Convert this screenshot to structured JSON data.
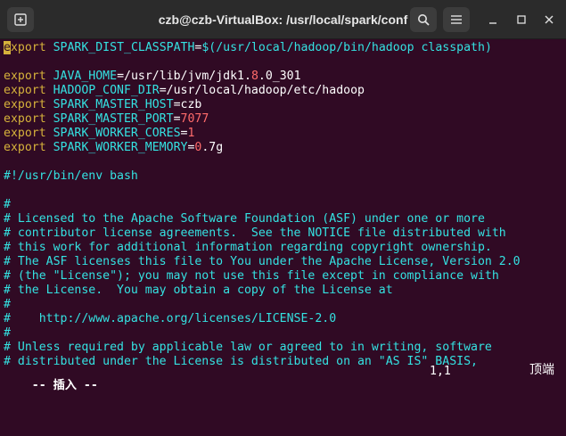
{
  "window": {
    "title": "czb@czb-VirtualBox: /usr/local/spark/conf"
  },
  "editor": {
    "lines": [
      {
        "kind": "export",
        "first_char": "e",
        "rest_kw": "xport",
        "var": "SPARK_DIST_CLASSPATH",
        "eq": "=",
        "value_parts": [
          {
            "t": "$(/usr/local/hadoop/bin/hadoop classpath)",
            "c": "var"
          }
        ]
      },
      {
        "kind": "blank"
      },
      {
        "kind": "export",
        "kw": "export",
        "var": "JAVA_HOME",
        "eq": "=",
        "value_parts": [
          {
            "t": "/usr/lib/jvm/jdk1.",
            "c": "plain"
          },
          {
            "t": "8",
            "c": "num"
          },
          {
            "t": ".0_301",
            "c": "plain"
          }
        ]
      },
      {
        "kind": "export",
        "kw": "export",
        "var": "HADOOP_CONF_DIR",
        "eq": "=",
        "value_parts": [
          {
            "t": "/usr/local/hadoop/etc/hadoop",
            "c": "plain"
          }
        ]
      },
      {
        "kind": "export",
        "kw": "export",
        "var": "SPARK_MASTER_HOST",
        "eq": "=",
        "value_parts": [
          {
            "t": "czb",
            "c": "plain"
          }
        ]
      },
      {
        "kind": "export",
        "kw": "export",
        "var": "SPARK_MASTER_PORT",
        "eq": "=",
        "value_parts": [
          {
            "t": "7077",
            "c": "num"
          }
        ]
      },
      {
        "kind": "export",
        "kw": "export",
        "var": "SPARK_WORKER_CORES",
        "eq": "=",
        "value_parts": [
          {
            "t": "1",
            "c": "num"
          }
        ]
      },
      {
        "kind": "export",
        "kw": "export",
        "var": "SPARK_WORKER_MEMORY",
        "eq": "=",
        "value_parts": [
          {
            "t": "0",
            "c": "num"
          },
          {
            "t": ".7g",
            "c": "plain"
          }
        ]
      },
      {
        "kind": "blank"
      },
      {
        "kind": "comment",
        "text": "#!/usr/bin/env bash"
      },
      {
        "kind": "blank"
      },
      {
        "kind": "comment",
        "text": "#"
      },
      {
        "kind": "comment",
        "text": "# Licensed to the Apache Software Foundation (ASF) under one or more"
      },
      {
        "kind": "comment",
        "text": "# contributor license agreements.  See the NOTICE file distributed with"
      },
      {
        "kind": "comment",
        "text": "# this work for additional information regarding copyright ownership."
      },
      {
        "kind": "comment",
        "text": "# The ASF licenses this file to You under the Apache License, Version 2.0"
      },
      {
        "kind": "comment",
        "text": "# (the \"License\"); you may not use this file except in compliance with"
      },
      {
        "kind": "comment",
        "text": "# the License.  You may obtain a copy of the License at"
      },
      {
        "kind": "comment",
        "text": "#"
      },
      {
        "kind": "comment",
        "text": "#    http://www.apache.org/licenses/LICENSE-2.0"
      },
      {
        "kind": "comment",
        "text": "#"
      },
      {
        "kind": "comment",
        "text": "# Unless required by applicable law or agreed to in writing, software"
      },
      {
        "kind": "comment",
        "text": "# distributed under the License is distributed on an \"AS IS\" BASIS,"
      }
    ]
  },
  "statusbar": {
    "mode": "-- 插入 --",
    "position": "1,1",
    "location": "顶端"
  },
  "icons": {
    "new_tab": "new-tab-icon",
    "search": "search-icon",
    "menu": "hamburger-menu-icon",
    "minimize": "minimize-icon",
    "maximize": "maximize-icon",
    "close": "close-icon"
  }
}
